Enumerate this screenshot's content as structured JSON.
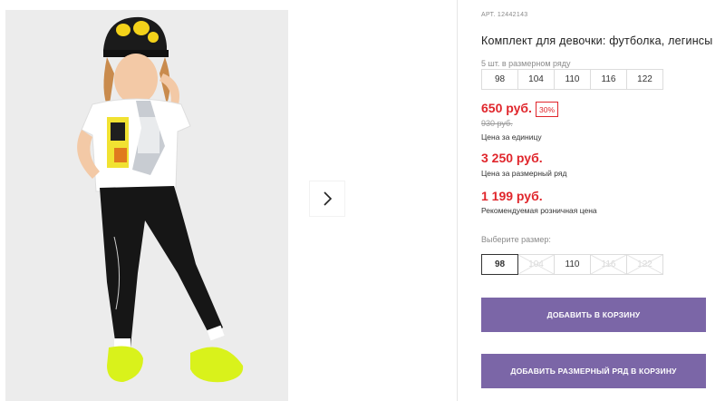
{
  "gallery": {
    "image_alt": "",
    "next_icon": "chevron-right-icon"
  },
  "product": {
    "sku": "АРТ. 12442143",
    "title": "Комплект для девочки: футболка, легинсы",
    "pack_label": "5 шт. в размерном ряду",
    "pack_sizes": [
      "98",
      "104",
      "110",
      "116",
      "122"
    ],
    "price": "650 руб.",
    "discount": "30%",
    "old_price": "930 руб.",
    "price_caption": "Цена за единицу",
    "pack_price": "3 250 руб.",
    "pack_price_caption": "Цена за размерный ряд",
    "rrp_price": "1 199 руб.",
    "rrp_caption": "Рекомендуемая розничная цена",
    "choose_size_label": "Выберите размер:",
    "sizes": [
      {
        "label": "98",
        "state": "selected"
      },
      {
        "label": "104",
        "state": "disabled"
      },
      {
        "label": "110",
        "state": "available"
      },
      {
        "label": "116",
        "state": "disabled"
      },
      {
        "label": "122",
        "state": "disabled"
      }
    ],
    "add_to_cart_label": "Добавить в корзину",
    "add_pack_to_cart_label": "Добавить размерный ряд в корзину"
  },
  "colors": {
    "accent": "#7b66a7",
    "price_red": "#e0262c",
    "muted": "#8a8a8a"
  }
}
